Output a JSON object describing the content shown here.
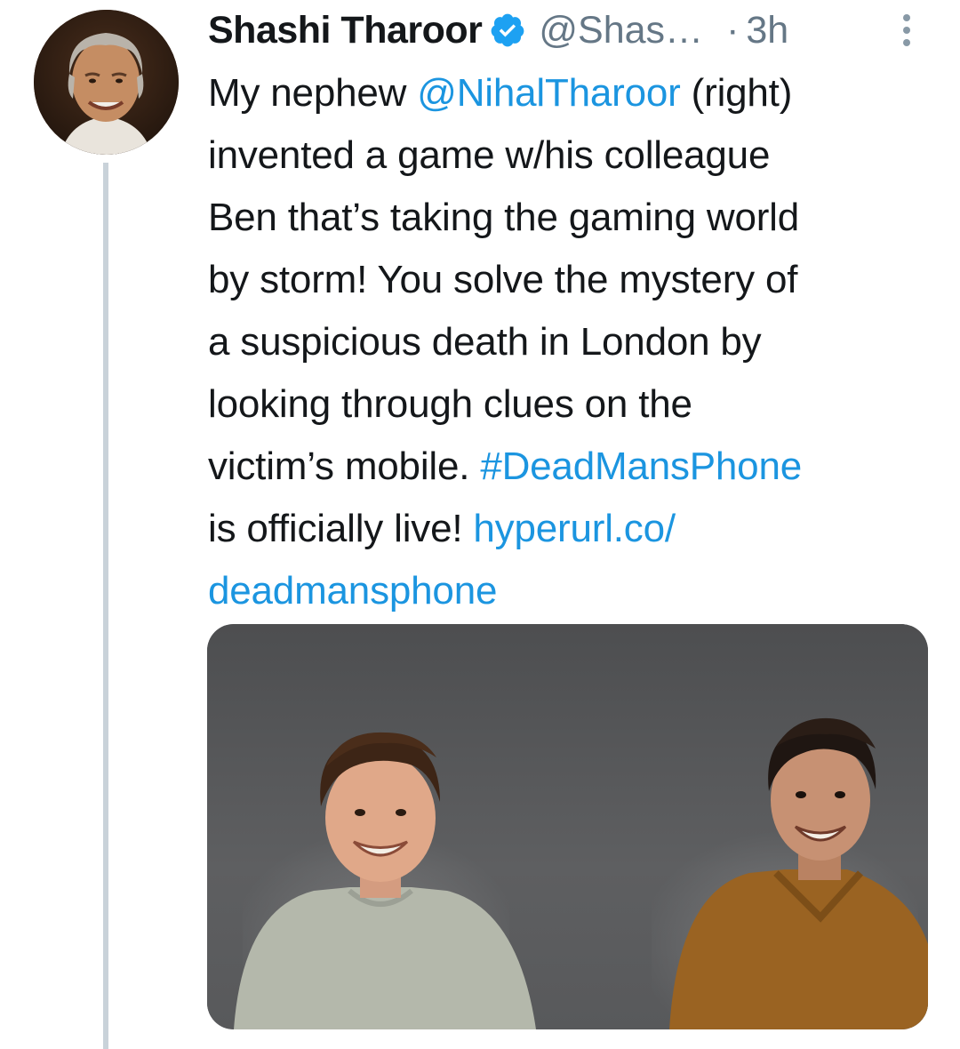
{
  "tweet": {
    "author_name": "Shashi Tharoor",
    "handle": "@Shas…",
    "separator": "·",
    "time": "3h",
    "lines": [
      [
        "My nephew ",
        "@NihalTharoor",
        " (right)"
      ],
      [
        "invented a game w/his colleague"
      ],
      [
        "Ben that’s taking the gaming world"
      ],
      [
        "by storm! You solve the mystery of"
      ],
      [
        "a suspicious death in London by"
      ],
      [
        "looking through clues on the"
      ],
      [
        "victim’s mobile. ",
        "#DeadMansPhone"
      ],
      [
        "is officially live! ",
        "hyperurl.co/"
      ],
      [
        "deadmansphone"
      ]
    ]
  },
  "icons": {
    "verified": "verified-badge-icon",
    "more": "more-vertical-icon"
  },
  "colors": {
    "link": "#1b95e0",
    "verified": "#1da1f2",
    "muted": "#657786",
    "thread_line": "#c9d2d9"
  }
}
